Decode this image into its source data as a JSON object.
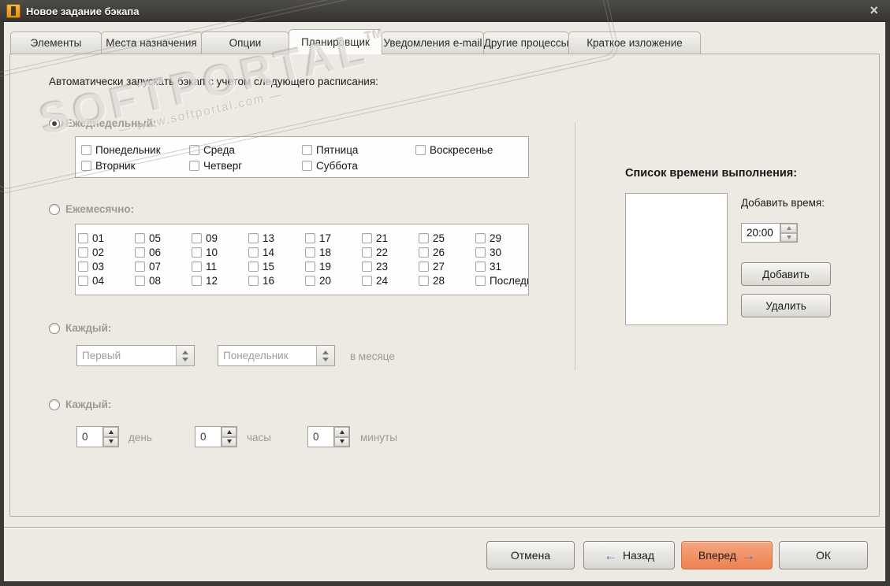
{
  "window": {
    "title": "Новое задание бэкапа",
    "close_icon": "×"
  },
  "watermark": {
    "brand": "SOFTPORTAL",
    "tm": "TM",
    "url": "— www.softportal.com —"
  },
  "tabs": [
    {
      "key": "elements",
      "label": "Элементы",
      "active": false
    },
    {
      "key": "destinations",
      "label": "Места назначения",
      "active": false
    },
    {
      "key": "options",
      "label": "Опции",
      "active": false
    },
    {
      "key": "scheduler",
      "label": "Планировщик",
      "active": true
    },
    {
      "key": "email-notifications",
      "label": "Уведомления e-mail",
      "active": false
    },
    {
      "key": "other-processes",
      "label": "Другие процессы",
      "active": false
    },
    {
      "key": "summary",
      "label": "Краткое изложение",
      "active": false
    }
  ],
  "scheduler": {
    "intro": "Автоматически запускать бэкап с учетом следующего расписания:",
    "weekly": {
      "label": "Ежеднедельный:",
      "selected": true,
      "days": [
        {
          "key": "monday",
          "label": "Понедельник"
        },
        {
          "key": "tuesday",
          "label": "Вторник"
        },
        {
          "key": "wednesday",
          "label": "Среда"
        },
        {
          "key": "thursday",
          "label": "Четверг"
        },
        {
          "key": "friday",
          "label": "Пятница"
        },
        {
          "key": "saturday",
          "label": "Суббота"
        },
        {
          "key": "sunday",
          "label": "Воскресенье"
        }
      ]
    },
    "monthly": {
      "label": "Ежемесячно:",
      "selected": false,
      "days": [
        {
          "key": "01",
          "label": "01"
        },
        {
          "key": "02",
          "label": "02"
        },
        {
          "key": "03",
          "label": "03"
        },
        {
          "key": "04",
          "label": "04"
        },
        {
          "key": "05",
          "label": "05"
        },
        {
          "key": "06",
          "label": "06"
        },
        {
          "key": "07",
          "label": "07"
        },
        {
          "key": "08",
          "label": "08"
        },
        {
          "key": "09",
          "label": "09"
        },
        {
          "key": "10",
          "label": "10"
        },
        {
          "key": "11",
          "label": "11"
        },
        {
          "key": "12",
          "label": "12"
        },
        {
          "key": "13",
          "label": "13"
        },
        {
          "key": "14",
          "label": "14"
        },
        {
          "key": "15",
          "label": "15"
        },
        {
          "key": "16",
          "label": "16"
        },
        {
          "key": "17",
          "label": "17"
        },
        {
          "key": "18",
          "label": "18"
        },
        {
          "key": "19",
          "label": "19"
        },
        {
          "key": "20",
          "label": "20"
        },
        {
          "key": "21",
          "label": "21"
        },
        {
          "key": "22",
          "label": "22"
        },
        {
          "key": "23",
          "label": "23"
        },
        {
          "key": "24",
          "label": "24"
        },
        {
          "key": "25",
          "label": "25"
        },
        {
          "key": "26",
          "label": "26"
        },
        {
          "key": "27",
          "label": "27"
        },
        {
          "key": "28",
          "label": "28"
        },
        {
          "key": "29",
          "label": "29"
        },
        {
          "key": "30",
          "label": "30"
        },
        {
          "key": "31",
          "label": "31"
        },
        {
          "key": "last",
          "label": "Последний"
        }
      ]
    },
    "monthly_weekday": {
      "label": "Каждый:",
      "selected": false,
      "ordinal_value": "Первый",
      "weekday_value": "Понедельник",
      "suffix": "в месяце"
    },
    "interval": {
      "label": "Каждый:",
      "selected": false,
      "fields": [
        {
          "value": "0",
          "unit": "день"
        },
        {
          "value": "0",
          "unit": "часы"
        },
        {
          "value": "0",
          "unit": "минуты"
        }
      ]
    }
  },
  "time_panel": {
    "title": "Список времени выполнения:",
    "items": [],
    "add_time_label": "Добавить время:",
    "time_value": "20:00",
    "add_label": "Добавить",
    "delete_label": "Удалить"
  },
  "footer": {
    "cancel": "Отмена",
    "back_arrow": "←",
    "back": "Назад",
    "forward": "Вперед",
    "forward_arrow": "→",
    "ok": "ОК"
  },
  "colors": {
    "titlebar": "#3b3935",
    "dialog_bg": "#edeae4",
    "accent_orange": "#ee8151",
    "arrow_blue": "#54719f",
    "disabled_text": "#9d9993"
  }
}
